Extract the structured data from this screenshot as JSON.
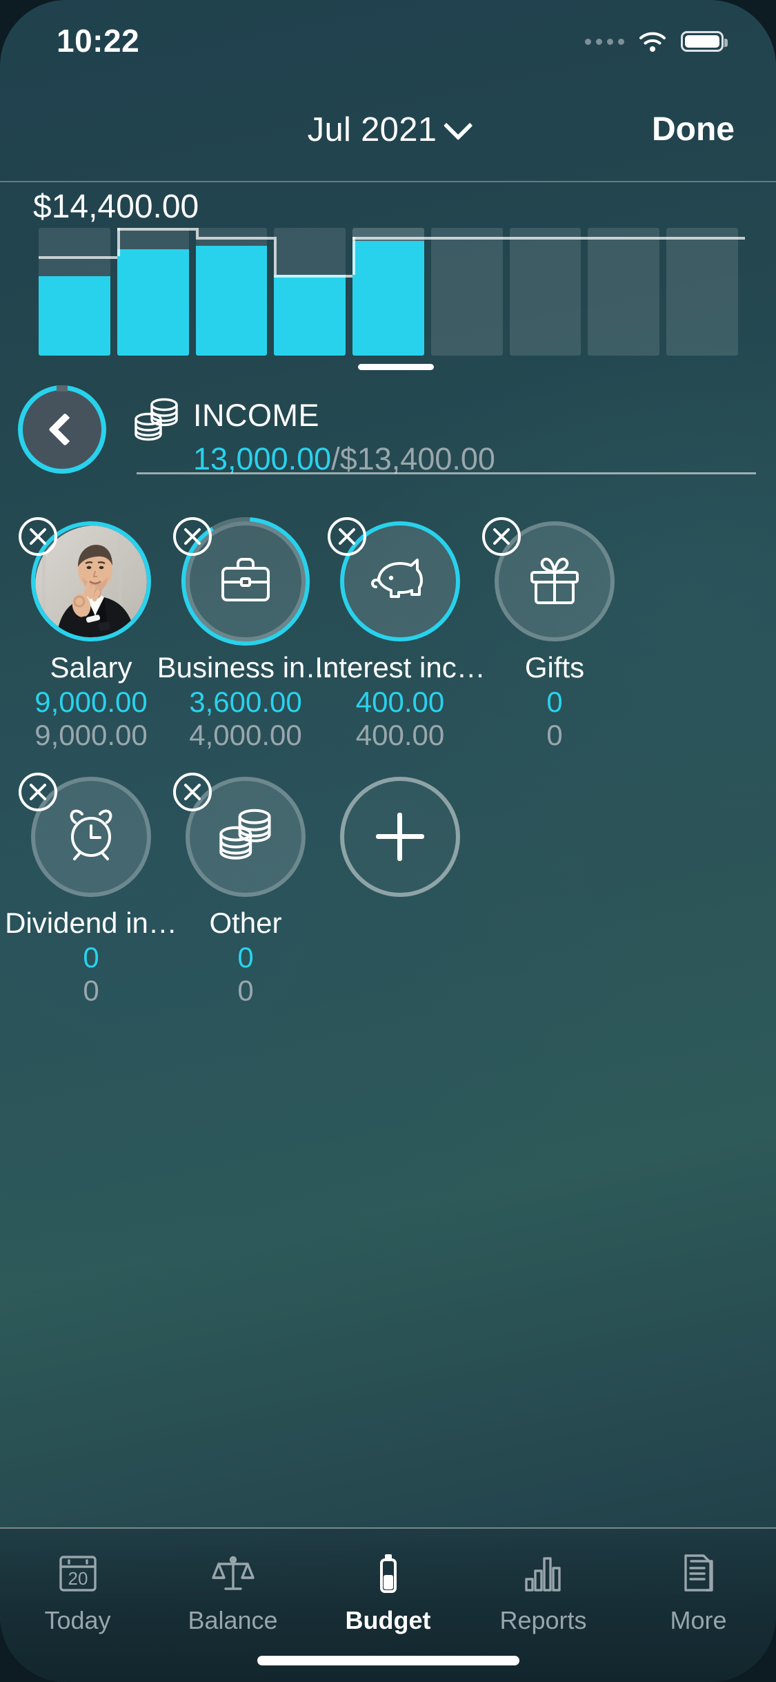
{
  "status_bar": {
    "time": "10:22",
    "signal_icon": "signal-dots-icon",
    "wifi_icon": "wifi-icon",
    "battery_icon": "battery-icon"
  },
  "header": {
    "month": "Jul 2021",
    "chevron_icon": "chevron-down-icon",
    "done_label": "Done"
  },
  "chart": {
    "amount_label": "$14,400.00",
    "bars": [
      {
        "index": 0,
        "fill_pct": 62,
        "budget_pct": 78,
        "state": "past"
      },
      {
        "index": 1,
        "fill_pct": 83,
        "budget_pct": 100,
        "state": "past"
      },
      {
        "index": 2,
        "fill_pct": 86,
        "budget_pct": 93,
        "state": "past"
      },
      {
        "index": 3,
        "fill_pct": 63,
        "budget_pct": 63,
        "state": "past"
      },
      {
        "index": 4,
        "fill_pct": 90,
        "budget_pct": 93,
        "state": "selected"
      },
      {
        "index": 5,
        "fill_pct": 0,
        "budget_pct": 93,
        "state": "future"
      },
      {
        "index": 6,
        "fill_pct": 0,
        "budget_pct": 93,
        "state": "future"
      },
      {
        "index": 7,
        "fill_pct": 0,
        "budget_pct": 93,
        "state": "future"
      },
      {
        "index": 8,
        "fill_pct": 0,
        "budget_pct": 93,
        "state": "future"
      }
    ]
  },
  "summary": {
    "back_icon": "chevron-left-icon",
    "category_icon": "coins-icon",
    "name": "INCOME",
    "spent": "13,000.00",
    "separator": "/",
    "total": "$13,400.00"
  },
  "categories": [
    {
      "label": "Salary",
      "spent": "9,000.00",
      "total": "9,000.00",
      "icon": "avatar-photo-icon",
      "ring": "full",
      "delete_icon": "close-icon"
    },
    {
      "label": "Business in…",
      "spent": "3,600.00",
      "total": "4,000.00",
      "icon": "briefcase-icon",
      "ring": "partial",
      "delete_icon": "close-icon"
    },
    {
      "label": "Interest inc…",
      "spent": "400.00",
      "total": "400.00",
      "icon": "piggy-bank-icon",
      "ring": "full",
      "delete_icon": "close-icon"
    },
    {
      "label": "Gifts",
      "spent": "0",
      "total": "0",
      "icon": "gift-icon",
      "ring": "none",
      "delete_icon": "close-icon"
    },
    {
      "label": "Dividend in…",
      "spent": "0",
      "total": "0",
      "icon": "alarm-clock-icon",
      "ring": "none",
      "delete_icon": "close-icon"
    },
    {
      "label": "Other",
      "spent": "0",
      "total": "0",
      "icon": "coins-icon",
      "ring": "none",
      "delete_icon": "close-icon"
    }
  ],
  "add_category": {
    "icon": "plus-icon",
    "label": ""
  },
  "tabbar": {
    "items": [
      {
        "label": "Today",
        "icon": "calendar-20-icon",
        "active": false
      },
      {
        "label": "Balance",
        "icon": "scales-icon",
        "active": false
      },
      {
        "label": "Budget",
        "icon": "battery-icon",
        "active": true
      },
      {
        "label": "Reports",
        "icon": "bar-chart-icon",
        "active": false
      },
      {
        "label": "More",
        "icon": "documents-icon",
        "active": false
      }
    ]
  },
  "colors": {
    "accent": "#29d2ec",
    "muted": "#9aa7ad",
    "background": "#2b5258"
  }
}
